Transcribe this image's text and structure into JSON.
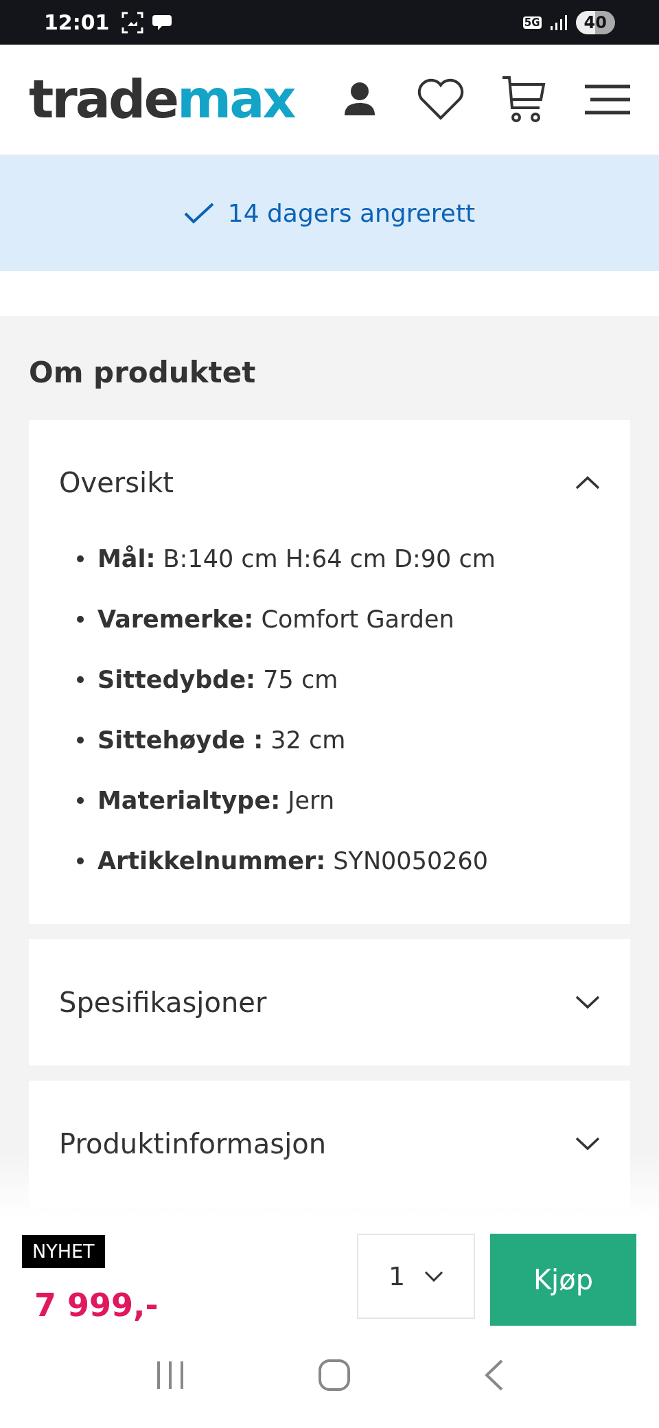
{
  "status_bar": {
    "time": "12:01",
    "network": "5G",
    "battery": "40"
  },
  "header": {
    "logo": {
      "first": "trade",
      "second": "max"
    }
  },
  "banner": {
    "text": "14 dagers angrerett"
  },
  "section": {
    "title": "Om produktet"
  },
  "accordions": [
    {
      "title": "Oversikt",
      "expanded": true,
      "items": [
        "**Mål:** B:140 cm H:64 cm D:90 cm",
        "**Varemerke:** Comfort Garden",
        "**Sittedybde:** 75 cm",
        "**Sittehøyde :** 32 cm",
        "**Materialtype:** Jern",
        "**Artikkelnummer:** SYN0050260"
      ]
    },
    {
      "title": "Spesifikasjoner",
      "expanded": false
    },
    {
      "title": "Produktinformasjon",
      "expanded": false
    }
  ],
  "buy_bar": {
    "badge": "NYHET",
    "price": "7 999,-",
    "quantity": "1",
    "button": "Kjøp"
  }
}
